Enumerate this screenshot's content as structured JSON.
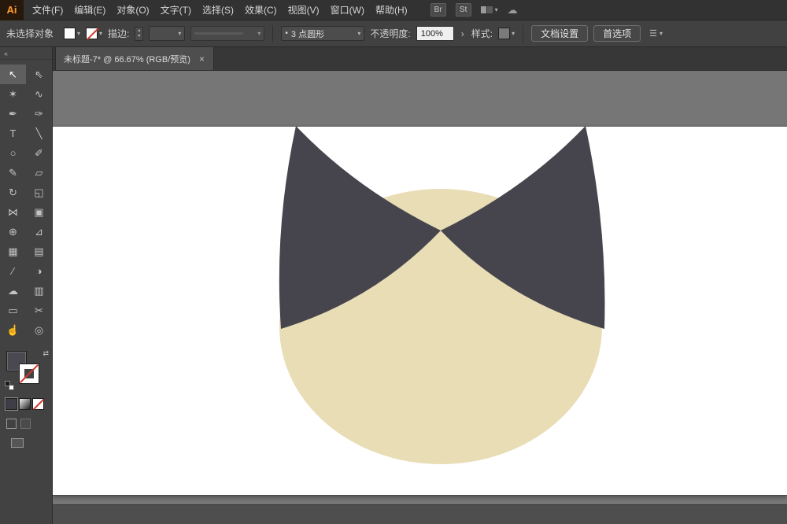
{
  "app": {
    "logo": "Ai"
  },
  "glyphs": {
    "caret": "▾",
    "caret_right": "›",
    "up": "▴",
    "down": "▾",
    "swap": "⇄",
    "bullet": "•"
  },
  "menubar": {
    "items": [
      "文件(F)",
      "编辑(E)",
      "对象(O)",
      "文字(T)",
      "选择(S)",
      "效果(C)",
      "视图(V)",
      "窗口(W)",
      "帮助(H)"
    ],
    "badges": {
      "bridge": "Br",
      "stock": "St"
    }
  },
  "controlbar": {
    "selection_status": "未选择对象",
    "stroke_label": "描边:",
    "brush_name": "3 点圆形",
    "opacity_label": "不透明度:",
    "opacity_value": "100%",
    "style_label": "样式:",
    "document_setup": "文档设置",
    "preferences": "首选项"
  },
  "tabbar": {
    "collapse_glyph": "«",
    "tab_title": "未标题-7* @ 66.67% (RGB/预览)",
    "close_glyph": "×"
  },
  "toolbar": {
    "fill_color": "#4a4952",
    "tools": [
      {
        "name": "selection",
        "glyph": "↖",
        "active": true
      },
      {
        "name": "direct-selection",
        "glyph": "⇖"
      },
      {
        "name": "magic-wand",
        "glyph": "✶"
      },
      {
        "name": "lasso",
        "glyph": "∿"
      },
      {
        "name": "pen",
        "glyph": "✒"
      },
      {
        "name": "add-anchor-point",
        "glyph": "✑"
      },
      {
        "name": "type",
        "glyph": "T"
      },
      {
        "name": "line-segment",
        "glyph": "╲"
      },
      {
        "name": "ellipse",
        "glyph": "○"
      },
      {
        "name": "paintbrush",
        "glyph": "✐"
      },
      {
        "name": "pencil",
        "glyph": "✎"
      },
      {
        "name": "eraser",
        "glyph": "▱"
      },
      {
        "name": "rotate",
        "glyph": "↻"
      },
      {
        "name": "scale",
        "glyph": "◱"
      },
      {
        "name": "width",
        "glyph": "⋈"
      },
      {
        "name": "free-transform",
        "glyph": "▣"
      },
      {
        "name": "shape-builder",
        "glyph": "⊕"
      },
      {
        "name": "perspective-grid",
        "glyph": "⊿"
      },
      {
        "name": "mesh",
        "glyph": "▦"
      },
      {
        "name": "gradient",
        "glyph": "▤"
      },
      {
        "name": "eyedropper",
        "glyph": "∕"
      },
      {
        "name": "blend",
        "glyph": "◑"
      },
      {
        "name": "symbol-sprayer",
        "glyph": "☁"
      },
      {
        "name": "column-graph",
        "glyph": "▥"
      },
      {
        "name": "artboard",
        "glyph": "▭"
      },
      {
        "name": "slice",
        "glyph": "✂"
      },
      {
        "name": "hand",
        "glyph": "☝"
      },
      {
        "name": "zoom",
        "glyph": "◎"
      }
    ]
  },
  "canvas": {
    "pasteboard_color": "#767676",
    "artboard_color": "#ffffff",
    "cat": {
      "head_color": "#e8ddb5",
      "ear_color": "#46454e"
    }
  }
}
